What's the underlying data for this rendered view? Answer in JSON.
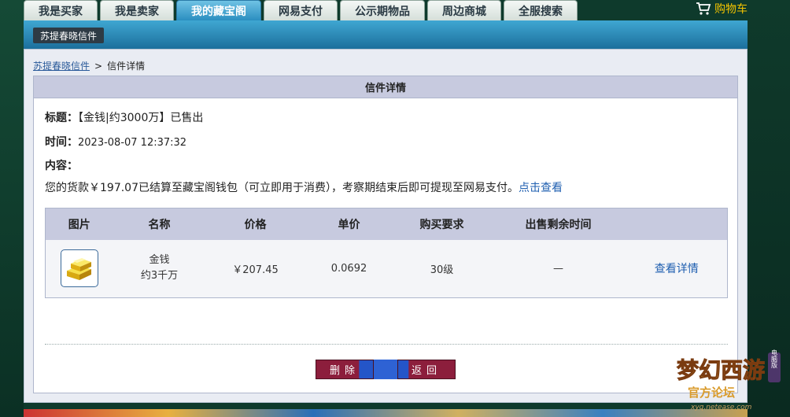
{
  "nav": {
    "tabs": [
      {
        "label": "我是买家"
      },
      {
        "label": "我是卖家"
      },
      {
        "label": "我的藏宝阁"
      },
      {
        "label": "网易支付"
      },
      {
        "label": "公示期物品"
      },
      {
        "label": "周边商城"
      },
      {
        "label": "全服搜索"
      }
    ],
    "active_tab": "我的藏宝阁",
    "cart_label": "购物车"
  },
  "header": {
    "user_label": "苏提春晓信件"
  },
  "breadcrumb": {
    "link": "苏提春晓信件",
    "separator": ">",
    "current": "信件详情"
  },
  "letter": {
    "card_title": "信件详情",
    "title_label": "标题：",
    "title_value": "【金钱|约3000万】已售出",
    "time_label": "时间：",
    "time_value": "2023-08-07 12:37:32",
    "content_label": "内容：",
    "content_text": "您的货款￥197.07已结算至藏宝阁钱包（可立即用于消费），考察期结束后即可提现至网易支付。",
    "content_link": "点击查看"
  },
  "table": {
    "headers": [
      "图片",
      "名称",
      "价格",
      "单价",
      "购买要求",
      "出售剩余时间",
      ""
    ],
    "row": {
      "name_line1": "金钱",
      "name_line2": "约3千万",
      "price": "￥207.45",
      "unit_price": "0.0692",
      "requirement": "30级",
      "remaining": "—",
      "detail_link": "查看详情"
    }
  },
  "buttons": {
    "delete": "删除",
    "back": "返回"
  },
  "logo": {
    "text_main": "梦幻西游",
    "text_sub": "官方论坛",
    "url": "xyq.netease.com",
    "side_text": "电脑版"
  },
  "colors": {
    "accent_blue": "#2b8ec0",
    "cart_yellow": "#f4c400",
    "button_maroon": "#8c1e3c",
    "link_blue": "#1f5fb0"
  }
}
